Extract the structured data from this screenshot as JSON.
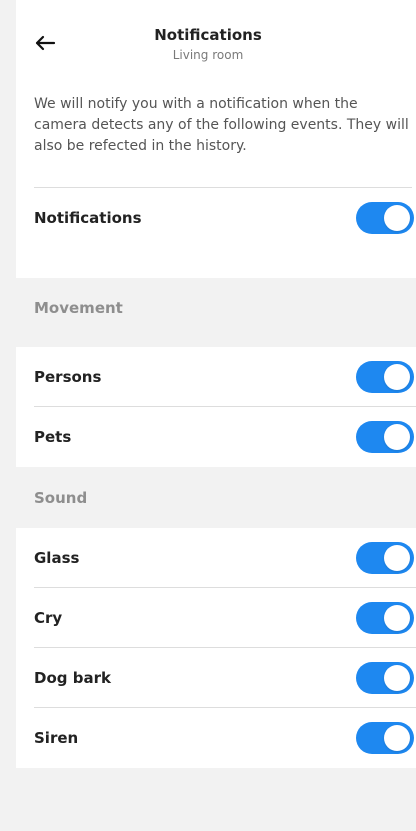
{
  "header": {
    "title": "Notifications",
    "subtitle": "Living room"
  },
  "intro": {
    "text": "We will notify you with a notification when the camera detects any of the following events. They will also be refected in the history."
  },
  "notifications": {
    "label": "Notifications",
    "enabled": true
  },
  "sections": {
    "movement": "Movement",
    "sound": "Sound"
  },
  "events": [
    {
      "label": "Persons",
      "enabled": true
    },
    {
      "label": "Pets",
      "enabled": true
    },
    {
      "label": "Glass",
      "enabled": true
    },
    {
      "label": "Cry",
      "enabled": true
    },
    {
      "label": "Dog bark",
      "enabled": true
    },
    {
      "label": "Siren",
      "enabled": true
    }
  ],
  "colors": {
    "accent": "#1e88f0",
    "background": "#f2f2f2",
    "surface": "#ffffff",
    "muted_text": "#8e8e8e"
  },
  "icons": {
    "back": "arrow-left-icon"
  }
}
